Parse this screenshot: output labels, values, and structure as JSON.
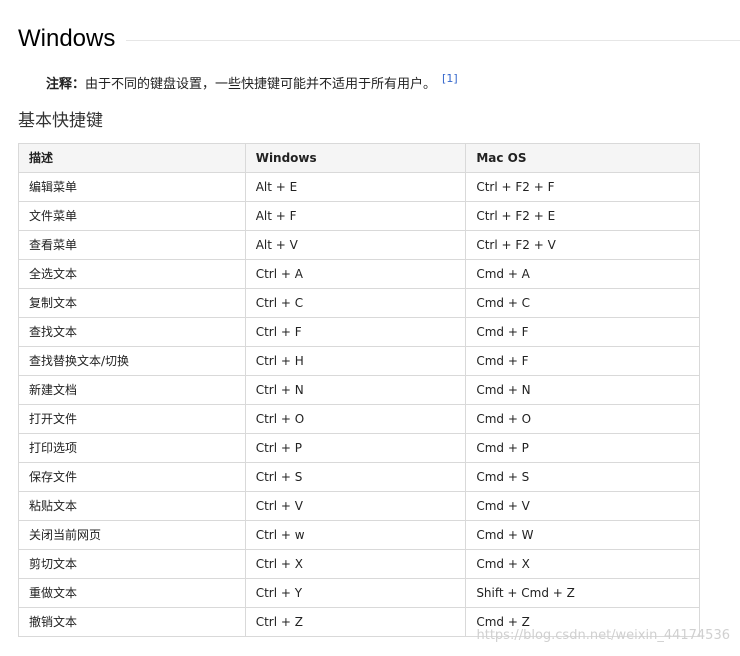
{
  "section_title": "Windows",
  "note": {
    "label": "注释：",
    "text": "由于不同的键盘设置，一些快捷键可能并不适用于所有用户。",
    "ref": "[1]"
  },
  "subsection_title": "基本快捷键",
  "table": {
    "headers": [
      "描述",
      "Windows",
      "Mac OS"
    ],
    "rows": [
      [
        "编辑菜单",
        "Alt + E",
        "Ctrl + F2 + F"
      ],
      [
        "文件菜单",
        "Alt + F",
        "Ctrl + F2 + E"
      ],
      [
        "查看菜单",
        "Alt + V",
        "Ctrl + F2 + V"
      ],
      [
        "全选文本",
        "Ctrl + A",
        "Cmd + A"
      ],
      [
        "复制文本",
        "Ctrl + C",
        "Cmd + C"
      ],
      [
        "查找文本",
        "Ctrl + F",
        "Cmd + F"
      ],
      [
        "查找替换文本/切换",
        "Ctrl + H",
        "Cmd + F"
      ],
      [
        "新建文档",
        "Ctrl + N",
        "Cmd + N"
      ],
      [
        "打开文件",
        "Ctrl + O",
        "Cmd + O"
      ],
      [
        "打印选项",
        "Ctrl + P",
        "Cmd + P"
      ],
      [
        "保存文件",
        "Ctrl + S",
        "Cmd + S"
      ],
      [
        "粘贴文本",
        "Ctrl + V",
        "Cmd + V"
      ],
      [
        "关闭当前网页",
        "Ctrl + w",
        "Cmd + W"
      ],
      [
        "剪切文本",
        "Ctrl + X",
        "Cmd + X"
      ],
      [
        "重做文本",
        "Ctrl + Y",
        "Shift + Cmd + Z"
      ],
      [
        "撤销文本",
        "Ctrl + Z",
        "Cmd + Z"
      ]
    ]
  },
  "watermark": "https://blog.csdn.net/weixin_44174536"
}
